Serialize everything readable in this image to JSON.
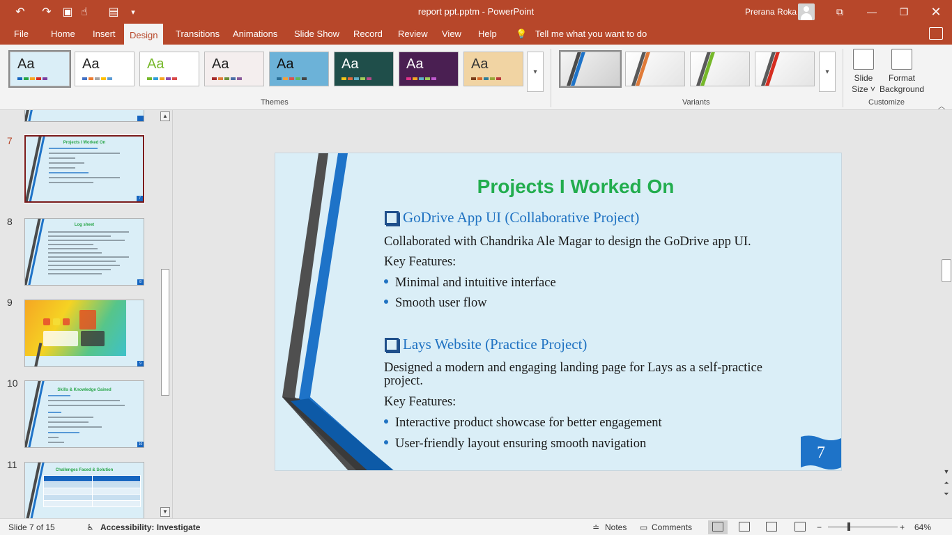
{
  "title_bar": {
    "document_title": "report ppt.pptm  -  PowerPoint",
    "user_name": "Prerana Roka",
    "quick_access": [
      "undo-icon",
      "redo-icon",
      "present-icon",
      "touch-mode-icon",
      "save-icon",
      "customize-qat-icon"
    ],
    "window_buttons": [
      "ribbon-display-icon",
      "minimize-icon",
      "restore-icon",
      "close-icon"
    ]
  },
  "ribbon_tabs": [
    "File",
    "Home",
    "Insert",
    "Design",
    "Transitions",
    "Animations",
    "Slide Show",
    "Record",
    "Review",
    "View",
    "Help"
  ],
  "active_tab": "Design",
  "tell_me": "Tell me what you want to do",
  "themes": {
    "group_label": "Themes",
    "items": [
      {
        "label": "Aa",
        "bg": "#daeef7",
        "fg": "#222222",
        "bars": [
          "#1565c0",
          "#27a547",
          "#f5a623",
          "#d62d20",
          "#7b3fa0"
        ]
      },
      {
        "label": "Aa",
        "bg": "#ffffff",
        "fg": "#222222",
        "bars": [
          "#4472c4",
          "#ed7d31",
          "#a5a5a5",
          "#ffc000",
          "#5b9bd5"
        ]
      },
      {
        "label": "Aa",
        "bg": "#ffffff",
        "fg": "#76b82a",
        "bars": [
          "#76b82a",
          "#2f9ed8",
          "#f5a623",
          "#8a4ab0",
          "#d94a4a"
        ]
      },
      {
        "label": "Aa",
        "bg": "#f4eeee",
        "fg": "#222222",
        "bars": [
          "#a52a2a",
          "#e07b39",
          "#6a8f3a",
          "#4a6fa5",
          "#8a5a9a"
        ]
      },
      {
        "label": "Aa",
        "bg": "#6cb2d8",
        "fg": "#111111",
        "bars": [
          "#2a6f97",
          "#f2a03d",
          "#d9534f",
          "#5cb85c",
          "#444444"
        ]
      },
      {
        "label": "Aa",
        "bg": "#1f4e4a",
        "fg": "#ffffff",
        "bars": [
          "#f5c518",
          "#e06a3b",
          "#5fb0c8",
          "#9ecb5a",
          "#b84a8a"
        ]
      },
      {
        "label": "Aa",
        "bg": "#4a1f52",
        "fg": "#ffffff",
        "bars": [
          "#e0338a",
          "#f5a623",
          "#5fb0c8",
          "#9ecb5a",
          "#c05ad0"
        ]
      },
      {
        "label": "Aa",
        "bg": "#f1d4a3",
        "fg": "#333333",
        "bars": [
          "#7a3e1a",
          "#d66a2a",
          "#2f7e9a",
          "#9aa83a",
          "#b83a3a"
        ]
      }
    ]
  },
  "variants": {
    "group_label": "Variants",
    "items": [
      {
        "stripes": [
          "#4a4a4a",
          "#1e73c8"
        ]
      },
      {
        "stripes": [
          "#5a5a5a",
          "#e07b39"
        ]
      },
      {
        "stripes": [
          "#5a5a5a",
          "#76b82a"
        ]
      },
      {
        "stripes": [
          "#5a5a5a",
          "#d62d20"
        ]
      }
    ]
  },
  "customize": {
    "group_label": "Customize",
    "slide_size_line1": "Slide",
    "slide_size_line2": "Size ˅",
    "format_bg_line1": "Format",
    "format_bg_line2": "Background"
  },
  "slide_panel": {
    "slides": [
      {
        "number": "7",
        "title": "Projects I Worked On",
        "current": true,
        "badge": "7"
      },
      {
        "number": "8",
        "title": "Log sheet",
        "current": false,
        "badge": "8"
      },
      {
        "number": "9",
        "title": "",
        "current": false,
        "badge": "9"
      },
      {
        "number": "10",
        "title": "Skills & Knowledge Gained",
        "current": false,
        "badge": "10"
      },
      {
        "number": "11",
        "title": "Challenges Faced & Solution",
        "current": false,
        "badge": ""
      }
    ]
  },
  "slide": {
    "title": "Projects I Worked On",
    "section1_heading": "GoDrive App UI (Collaborative Project)",
    "section1_desc": "Collaborated with Chandrika Ale Magar to design the GoDrive app UI.",
    "section1_key": "Key Features:",
    "section1_bullets": [
      "Minimal and intuitive interface",
      "Smooth user flow"
    ],
    "section2_heading": "Lays Website (Practice Project)",
    "section2_desc": "Designed a modern and engaging landing page for Lays as a self-practice project.",
    "section2_key": "Key Features:",
    "section2_bullets": [
      "Interactive product showcase for better engagement",
      "User-friendly layout ensuring smooth navigation"
    ],
    "page_number": "7"
  },
  "status_bar": {
    "slide_counter": "Slide 7 of 15",
    "accessibility": "Accessibility: Investigate",
    "notes": "Notes",
    "comments": "Comments",
    "zoom": "64%"
  },
  "colors": {
    "accent": "#b7472a",
    "slide_bg": "#daeef7",
    "title_green": "#22ad4e",
    "heading_blue": "#1f72c2"
  }
}
